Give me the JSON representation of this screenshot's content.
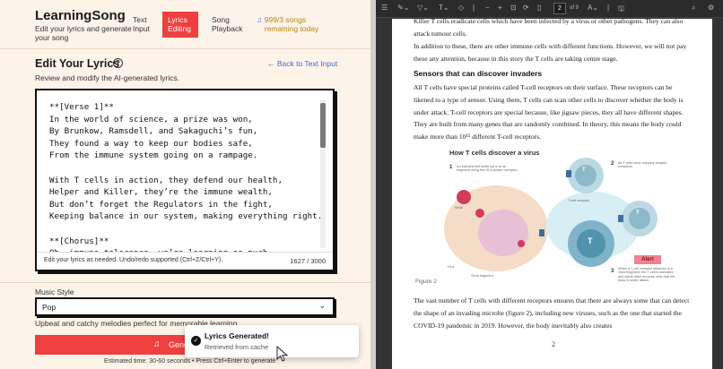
{
  "app": {
    "logo": "LearningSong",
    "tagline": "Edit your lyrics and generate your song",
    "nav": [
      {
        "label": "Text Input"
      },
      {
        "label": "Lyrics Editing",
        "active": true
      },
      {
        "label": "Song Playback"
      }
    ],
    "counter": {
      "icon": "music-note-icon",
      "label": "999/3 songs remaining today"
    },
    "section_title": "Edit Your Lyrics",
    "back_link": "← Back to Text Input",
    "subtitle": "Review and modify the AI-generated lyrics.",
    "lyrics": "**[Verse 1]**\nIn the world of science, a prize was won,\nBy Brunkow, Ramsdell, and Sakaguchi’s fun,\nThey found a way to keep our bodies safe,\nFrom the immune system going on a rampage.\n\nWith T cells in action, they defend our health,\nHelper and Killer, they’re the immune wealth,\nBut don’t forget the Regulators in the fight,\nKeeping balance in our system, making everything right.\n\n**[Chorus]**\nOh, immune tolerance, we’re learning so much,",
    "editor_hint": "Edit your lyrics as needed. Undo/redo supported (Ctrl+Z/Ctrl+Y).",
    "char_count": "1627 / 3000",
    "style_label": "Music Style",
    "style_value": "Pop",
    "style_desc": "Upbeat and catchy melodies perfect for memorable learning",
    "generate_label": "Gene",
    "estimate": "Estimated time: 30-60 seconds • Press Ctrl+Enter to generate",
    "toast": {
      "title": "Lyrics Generated!",
      "subtitle": "Retrieved from cache"
    },
    "accent": "#ef3f3f"
  },
  "pdf": {
    "page_current": "2",
    "page_total": "of 9",
    "para1": "Killer T cells eradicate cells which have been infected by a virus or other pathogens. They can also attack tumour cells.",
    "para2": "In addition to these, there are other immune cells with different functions. However, we will not pay these any attention, because in this story the T cells are taking centre stage.",
    "heading": "Sensors that can discover invaders",
    "para3": "All T cells have special proteins called T-cell receptors on their surface. These receptors can be likened to a type of sensor. Using them, T cells can scan other cells to discover whether the body is under attack. T-cell receptors are special because, like jigsaw pieces, they all have different shapes. They are built from many genes that are randomly combined. In theory, this means the body could make more than 10¹⁵ different T-cell receptors.",
    "figure": {
      "title": "How T cells discover a virus",
      "n1": "1",
      "t1": "An infected cell holds out a virus fragment using the HLA protein complex.",
      "n2": "2",
      "t2": "All T cells have uniquely shaped receptors.",
      "n3": "3",
      "t3": "When a T-cell receptor attaches to a virus fragment, the T cell is activated and alerts other immune cells that the body is under attack.",
      "virus": "Virus",
      "receptor": "T-cell receptor",
      "hla": "HLA",
      "fragment": "Virus fragment",
      "alert": "Alert",
      "t_letter": "T"
    },
    "caption": "Figure 2",
    "para4": "The vast number of T cells with different receptors ensures that there are always some that can detect the shape of an invading microbe (figure 2), including new viruses, such as the one that started the COVID-19 pandemic in 2019. However, the body inevitably also creates",
    "page_num": "2"
  }
}
